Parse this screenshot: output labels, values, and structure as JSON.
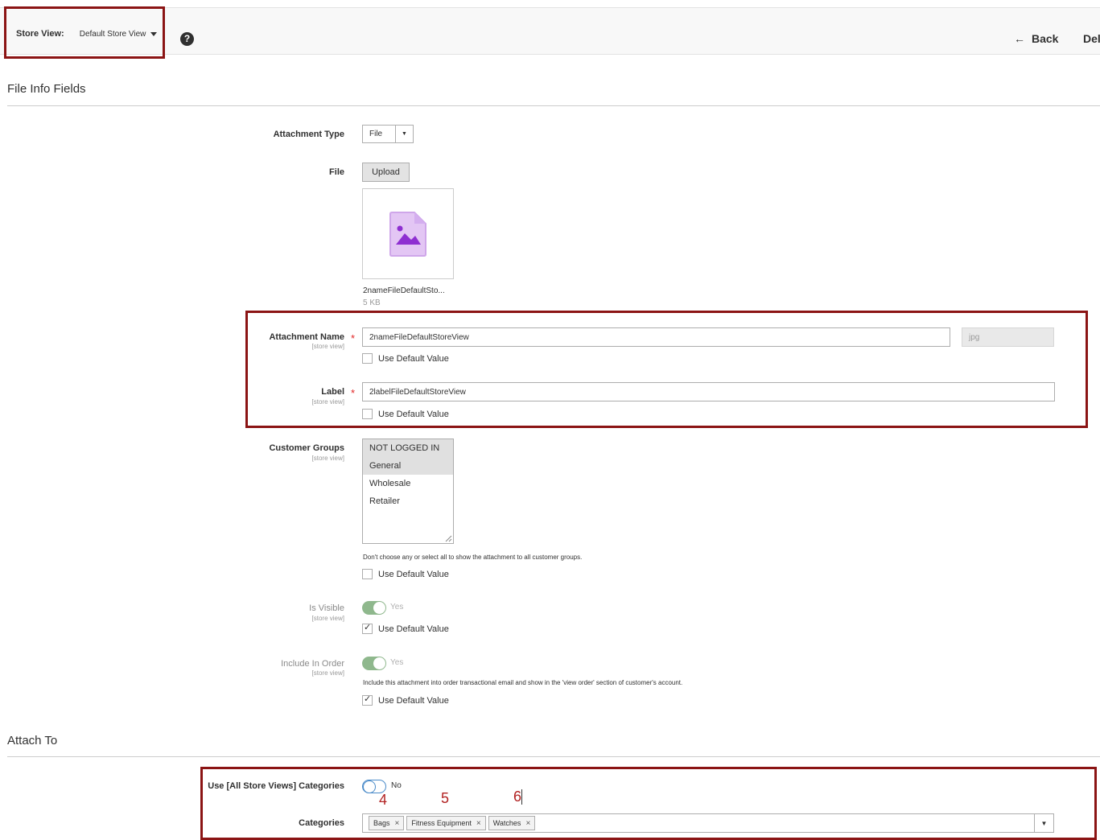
{
  "header": {
    "store_view_label": "Store View:",
    "store_view_value": "Default Store View",
    "help_glyph": "?",
    "back_label": "Back",
    "back_arrow": "←",
    "delete_label": "Del"
  },
  "sections": {
    "file_info_title": "File Info Fields",
    "attach_to_title": "Attach To"
  },
  "fields": {
    "attachment_type": {
      "label": "Attachment Type",
      "value": "File"
    },
    "file": {
      "label": "File",
      "upload_label": "Upload",
      "file_name": "2nameFileDefaultSto...",
      "file_size": "5 KB"
    },
    "attachment_name": {
      "label": "Attachment Name",
      "scope": "[store view]",
      "value": "2nameFileDefaultStoreView",
      "extension": "jpg",
      "use_default": "Use Default Value"
    },
    "label": {
      "label": "Label",
      "scope": "[store view]",
      "value": "2labelFileDefaultStoreView",
      "use_default": "Use Default Value"
    },
    "customer_groups": {
      "label": "Customer Groups",
      "scope": "[store view]",
      "options": [
        "NOT LOGGED IN",
        "General",
        "Wholesale",
        "Retailer"
      ],
      "note": "Don't choose any or select all to show the attachment to all customer groups.",
      "use_default": "Use Default Value"
    },
    "is_visible": {
      "label": "Is Visible",
      "scope": "[store view]",
      "state": "Yes",
      "use_default": "Use Default Value"
    },
    "include_in_order": {
      "label": "Include In Order",
      "scope": "[store view]",
      "state": "Yes",
      "note": "Include this attachment into order transactional email and show in the 'view order' section of customer's account.",
      "use_default": "Use Default Value"
    },
    "use_all_store_categories": {
      "label": "Use [All Store Views] Categories",
      "state": "No"
    },
    "categories": {
      "label": "Categories",
      "tags": [
        "Bags",
        "Fitness Equipment",
        "Watches"
      ]
    }
  },
  "annotations": [
    "4",
    "5",
    "6"
  ],
  "colors": {
    "highlight_border": "#8b1414",
    "toggle_on": "#8fb88d",
    "toggle_off_border": "#4a8bc9",
    "required_star": "#e22626"
  }
}
